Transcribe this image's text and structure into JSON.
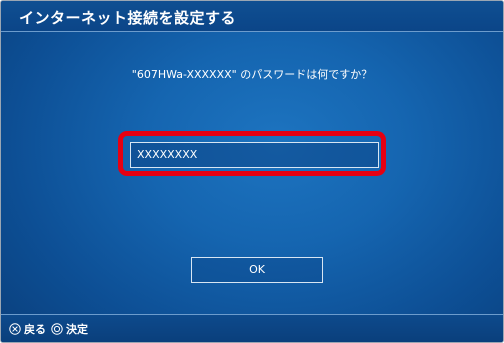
{
  "window": {
    "title": "インターネット接続を設定する"
  },
  "dialog": {
    "prompt": "\"607HWa-XXXXXX\" のパスワードは何ですか？",
    "password_value": "XXXXXXXX",
    "ok_label": "OK",
    "highlight_color": "#e60012"
  },
  "footer": {
    "back_icon": "cross-button-icon",
    "back_label": "戻る",
    "confirm_icon": "circle-button-icon",
    "confirm_label": "決定"
  },
  "colors": {
    "background": "#1565b0",
    "title_bar": "#0f4f92"
  }
}
